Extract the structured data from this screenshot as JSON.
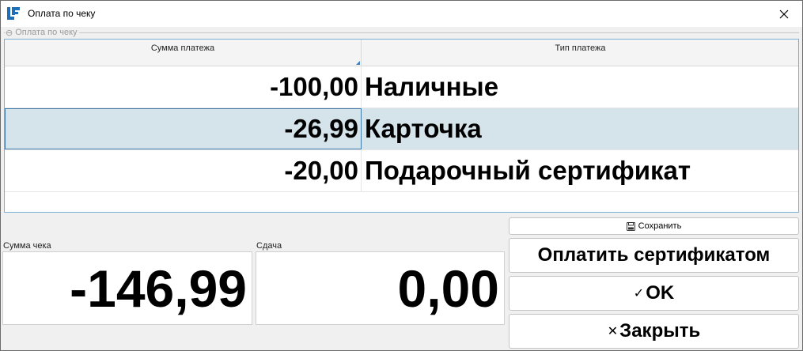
{
  "window": {
    "title": "Оплата по чеку",
    "close_glyph": "✕"
  },
  "group": {
    "legend": "Оплата по чеку",
    "collapse_glyph": "⊖"
  },
  "grid": {
    "columns": [
      {
        "label": "Сумма платежа"
      },
      {
        "label": "Тип платежа"
      }
    ],
    "rows": [
      {
        "amount": "-100,00",
        "type": "Наличные",
        "selected": false
      },
      {
        "amount": "-26,99",
        "type": "Карточка",
        "selected": true
      },
      {
        "amount": "-20,00",
        "type": "Подарочный сертификат",
        "selected": false
      }
    ]
  },
  "totals": {
    "sum_label": "Сумма чека",
    "sum_value": "-146,99",
    "change_label": "Сдача",
    "change_value": "0,00"
  },
  "buttons": {
    "save_label": "Сохранить",
    "save_icon": "floppy-disk-icon",
    "pay_certificate_label": "Оплатить сертификатом",
    "ok_label": "OK",
    "ok_glyph": "✓",
    "close_label": "Закрыть",
    "close_glyph": "✕"
  },
  "colors": {
    "selected_row": "#d4e4ea",
    "grid_border": "#7ab0d6",
    "icon_blue": "#1e6fb8"
  }
}
